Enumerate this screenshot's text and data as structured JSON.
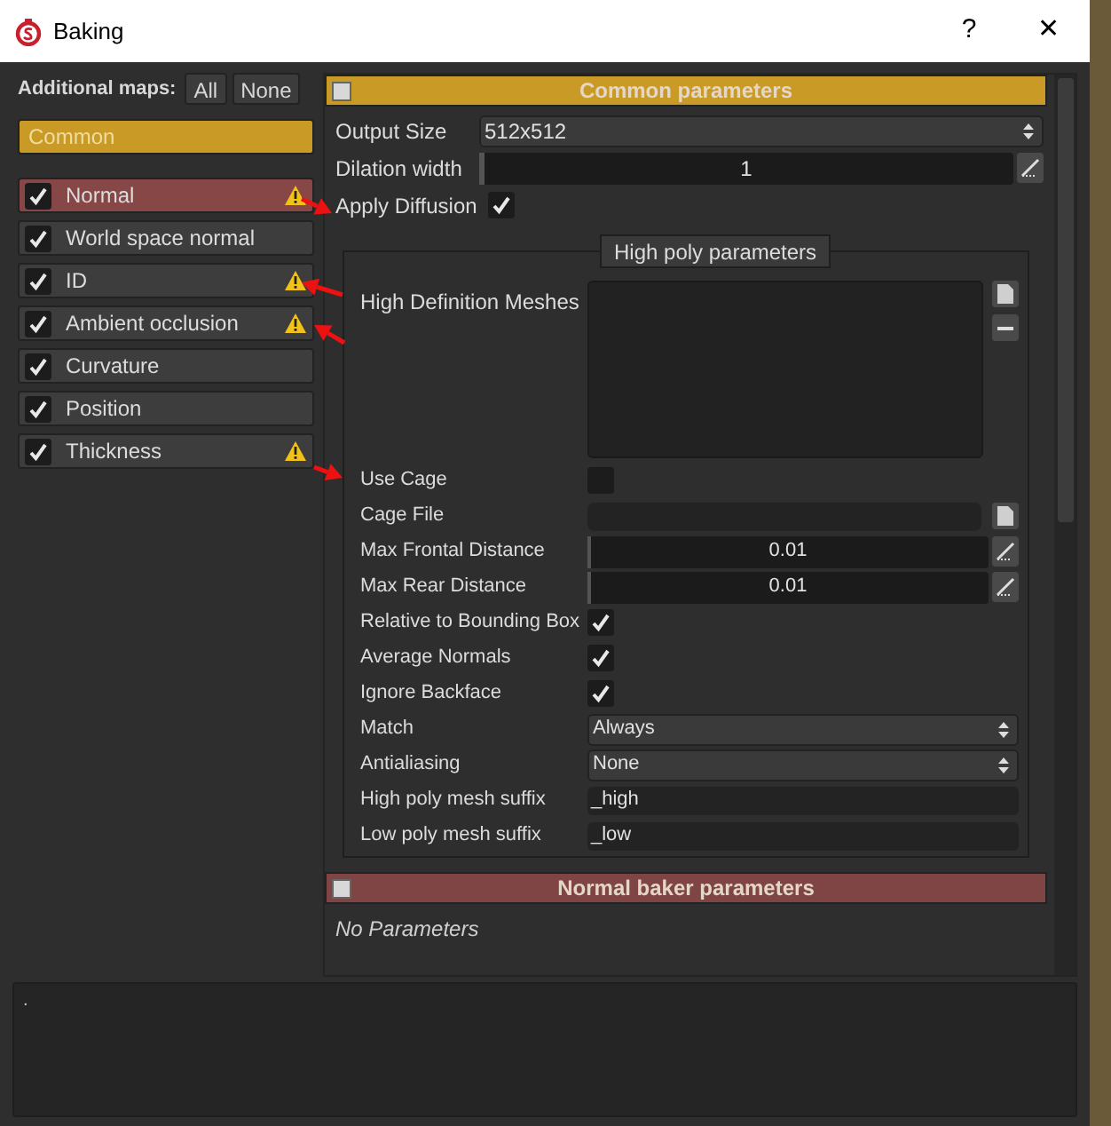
{
  "window": {
    "title": "Baking",
    "help": "?",
    "close": "✕"
  },
  "sidebar": {
    "label": "Additional maps:",
    "buttons": [
      "All",
      "None"
    ],
    "common": {
      "label": "Common",
      "selected": false
    },
    "items": [
      {
        "label": "Normal",
        "checked": true,
        "selected": true,
        "warning": true
      },
      {
        "label": "World space normal",
        "checked": true,
        "selected": false,
        "warning": false
      },
      {
        "label": "ID",
        "checked": true,
        "selected": false,
        "warning": true
      },
      {
        "label": "Ambient occlusion",
        "checked": true,
        "selected": false,
        "warning": true
      },
      {
        "label": "Curvature",
        "checked": true,
        "selected": false,
        "warning": false
      },
      {
        "label": "Position",
        "checked": true,
        "selected": false,
        "warning": false
      },
      {
        "label": "Thickness",
        "checked": true,
        "selected": false,
        "warning": true
      }
    ]
  },
  "common_parameters": {
    "title": "Common parameters",
    "expanded": false,
    "rows": [
      {
        "kind": "select",
        "label": "Output Size",
        "value": "512x512"
      },
      {
        "kind": "slider",
        "label": "Dilation width",
        "value": "1",
        "level": 0.01
      },
      {
        "kind": "checkbox",
        "label": "Apply Diffusion",
        "checked": true
      }
    ],
    "high_poly": {
      "title": "High poly parameters",
      "meshes_label": "High Definition Meshes",
      "rows": [
        {
          "kind": "checkbox",
          "label": "Use Cage",
          "checked": false
        },
        {
          "kind": "file",
          "label": "Cage File",
          "value": ""
        },
        {
          "kind": "slider",
          "label": "Max Frontal Distance",
          "value": "0.01",
          "level": 0.01
        },
        {
          "kind": "slider",
          "label": "Max Rear Distance",
          "value": "0.01",
          "level": 0.01
        },
        {
          "kind": "checkbox",
          "label": "Relative to Bounding Box",
          "checked": true
        },
        {
          "kind": "checkbox",
          "label": "Average Normals",
          "checked": true
        },
        {
          "kind": "checkbox",
          "label": "Ignore Backface",
          "checked": true
        },
        {
          "kind": "select",
          "label": "Match",
          "value": "Always"
        },
        {
          "kind": "select",
          "label": "Antialiasing",
          "value": "None"
        },
        {
          "kind": "text",
          "label": "High poly mesh suffix",
          "value": "_high"
        },
        {
          "kind": "text",
          "label": "Low poly mesh suffix",
          "value": "_low"
        }
      ]
    }
  },
  "normal_baker": {
    "title": "Normal baker parameters",
    "expanded": false,
    "note": "No Parameters"
  },
  "log": {
    "text": "."
  }
}
